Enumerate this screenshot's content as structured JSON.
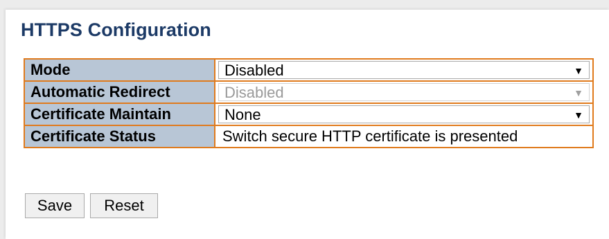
{
  "page": {
    "title": "HTTPS Configuration"
  },
  "config": {
    "rows": [
      {
        "label": "Mode",
        "type": "select",
        "value": "Disabled",
        "enabled": true
      },
      {
        "label": "Automatic Redirect",
        "type": "select",
        "value": "Disabled",
        "enabled": false
      },
      {
        "label": "Certificate Maintain",
        "type": "select",
        "value": "None",
        "enabled": true
      },
      {
        "label": "Certificate Status",
        "type": "text",
        "value": "Switch secure HTTP certificate is presented"
      }
    ]
  },
  "buttons": {
    "save_label": "Save",
    "reset_label": "Reset"
  },
  "icons": {
    "dropdown": "chevron-down-icon"
  },
  "colors": {
    "title": "#1c3a66",
    "table_border": "#e07a1c",
    "label_background": "#b8c6d6"
  }
}
